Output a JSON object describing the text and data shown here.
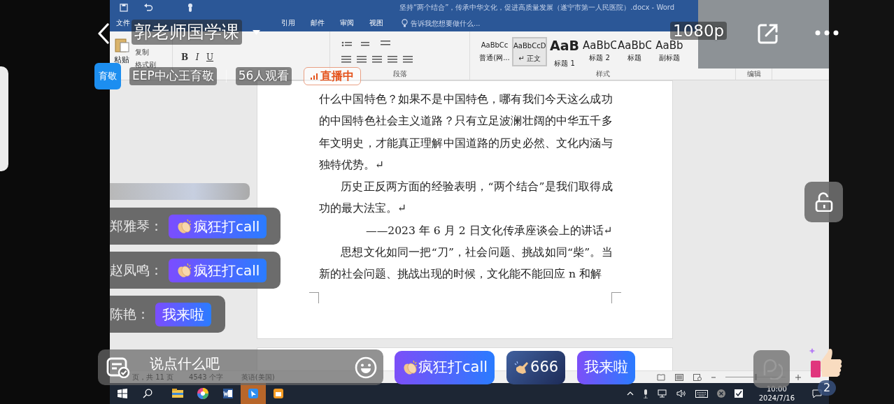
{
  "stream": {
    "title": "郭老师国学课",
    "quality": "1080p",
    "host": {
      "avatar_text": "育敬",
      "name": "EEP中心王育敬",
      "viewers": "56人观看"
    },
    "live_badge": "直播中",
    "likes": "2"
  },
  "word": {
    "doc_title": "坚持“两个结合”，传承中华文化，促进高质量发展（遂宁市第一人民医院）.docx - Word",
    "tabs": [
      {
        "label": "文件",
        "selected": false
      },
      {
        "label": "引用",
        "selected": false
      },
      {
        "label": "邮件",
        "selected": false
      },
      {
        "label": "审阅",
        "selected": false
      },
      {
        "label": "视图",
        "selected": false
      }
    ],
    "tell_me": "告诉我您想要做什么...",
    "clipboard": {
      "paste": "粘贴",
      "copy": "复制",
      "format_painter": "格式刷"
    },
    "format_buttons": [
      "B",
      "I",
      "U"
    ],
    "styles": [
      {
        "preview": "AaBbCc",
        "label": "普通(网...",
        "kind": "normal",
        "selected": false
      },
      {
        "preview": "AaBbCcD",
        "label": "↵ 正文",
        "kind": "normal",
        "selected": true
      },
      {
        "preview": "AaB",
        "label": "标题 1",
        "kind": "heading1",
        "selected": false
      },
      {
        "preview": "AaBbC",
        "label": "标题 2",
        "kind": "heading",
        "selected": false
      },
      {
        "preview": "AaBbC",
        "label": "标题",
        "kind": "heading",
        "selected": false
      },
      {
        "preview": "AaBb",
        "label": "副标题",
        "kind": "heading",
        "selected": false
      }
    ],
    "group_labels": [
      "段落",
      "样式",
      "编辑"
    ],
    "paragraphs": [
      {
        "kind": "continued",
        "text": "什么中国特色？如果不是中国特色，哪有我们今天这么成功的中国特色社会主义道路？只有立足波澜壮阔的中华五千多年文明史，才能真正理解中国道路的历史必然、文化内涵与独特优势。↵"
      },
      {
        "kind": "body",
        "text": "历史正反两方面的经验表明，“两个结合”是我们取得成功的最大法宝。↵"
      },
      {
        "kind": "citation",
        "text": "——2023 年 6 月 2 日文化传承座谈会上的讲话↵"
      },
      {
        "kind": "body",
        "text": "思想文化如同一把“刀”，社会问题、挑战如同“柴”。当新的社会问题、挑战出现的时候，文化能不能回应 n 和解"
      }
    ],
    "status": [
      "页，共 11 页",
      "4543 个字",
      "英语(美国)"
    ],
    "zoom_slider": {
      "level": 0.5
    },
    "taskbar": {
      "time": "10:00",
      "date": "2024/7/16"
    }
  },
  "chat": [
    {
      "user": "郑雅琴：",
      "message": "疯狂打call",
      "kind": "clap"
    },
    {
      "user": "赵凤鸣：",
      "message": "疯狂打call",
      "kind": "clap"
    },
    {
      "user": "陈艳：",
      "message": "我来啦",
      "kind": "plain"
    }
  ],
  "input": {
    "placeholder": "说点什么吧"
  },
  "quick_replies": [
    {
      "label": "疯狂打call",
      "kind": "clap"
    },
    {
      "label": "666",
      "kind": "shaka"
    },
    {
      "label": "我来啦",
      "kind": "plain"
    }
  ]
}
